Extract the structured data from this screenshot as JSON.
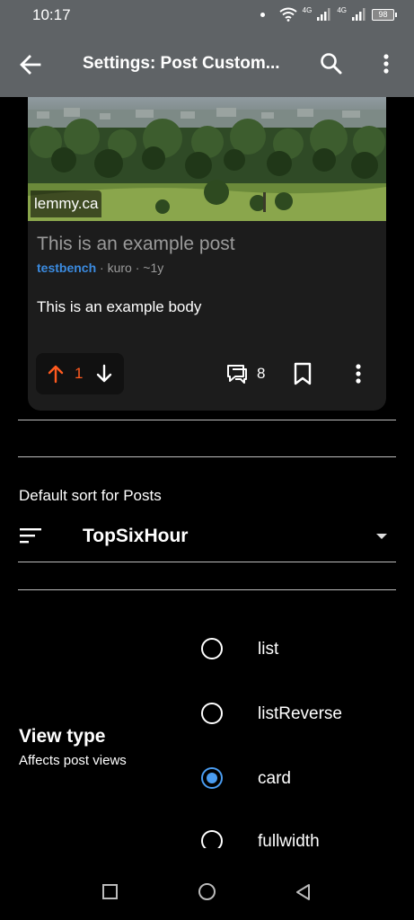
{
  "status_bar": {
    "time": "10:17",
    "network_1": "4G",
    "network_2": "4G",
    "battery": "98"
  },
  "app_bar": {
    "title": "Settings: Post Custom..."
  },
  "preview_post": {
    "site": "lemmy.ca",
    "title": "This is an example post",
    "community": "testbench",
    "separator_1": " · ",
    "author": "kuro",
    "separator_2": " · ",
    "age": "~1y",
    "body": "This is an example body",
    "score": "1",
    "comment_count": "8"
  },
  "sort": {
    "label": "Default sort for Posts",
    "value": "TopSixHour"
  },
  "view_type": {
    "title": "View type",
    "subtitle": "Affects post views",
    "options": [
      {
        "label": "list",
        "selected": false
      },
      {
        "label": "listReverse",
        "selected": false
      },
      {
        "label": "card",
        "selected": true
      },
      {
        "label": "fullwidth",
        "selected": false
      }
    ]
  },
  "colors": {
    "app_bar": "#5f6366",
    "accent": "#4a9cf0",
    "upvote": "#ff5a1f",
    "community": "#3b8be0"
  }
}
